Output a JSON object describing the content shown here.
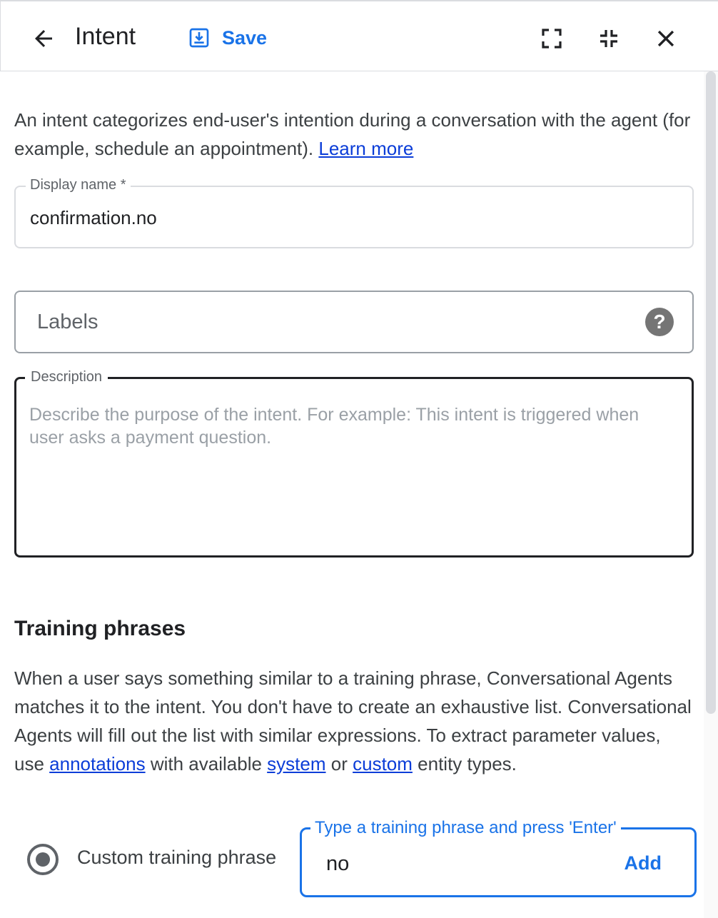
{
  "header": {
    "title": "Intent",
    "save_label": "Save",
    "icons": [
      "arrow-back-icon",
      "save-download-icon",
      "fullscreen-icon",
      "fullscreen-exit-icon",
      "close-icon"
    ]
  },
  "intro": {
    "text": "An intent categorizes end-user's intention during a conversation with the agent (for example, schedule an appointment).",
    "link": "Learn more"
  },
  "display_name": {
    "label": "Display name *",
    "value": "confirmation.no"
  },
  "labels": {
    "placeholder": "Labels"
  },
  "description": {
    "label": "Description",
    "placeholder": "Describe the purpose of the intent. For example: This intent is triggered when user asks a payment question.",
    "value": ""
  },
  "training": {
    "title": "Training phrases",
    "desc_1": "When a user says something similar to a training phrase, Conversational Agents matches it to the intent. You don't have to create an exhaustive list. Conversational Agents will fill out the list with similar expressions. To extract parameter values, use",
    "link_annotations": "annotations",
    "desc_2": "with available",
    "link_system": "system",
    "desc_3": "or",
    "link_custom": "custom",
    "desc_4": "entity types.",
    "radio_label": "Custom training phrase",
    "phrase_label": "Type a training phrase and press 'Enter'",
    "phrase_value": "no",
    "add_label": "Add"
  },
  "colors": {
    "accent": "#1a73e8",
    "link": "#0b3dd8",
    "text": "#202124",
    "muted": "#5f6368"
  }
}
